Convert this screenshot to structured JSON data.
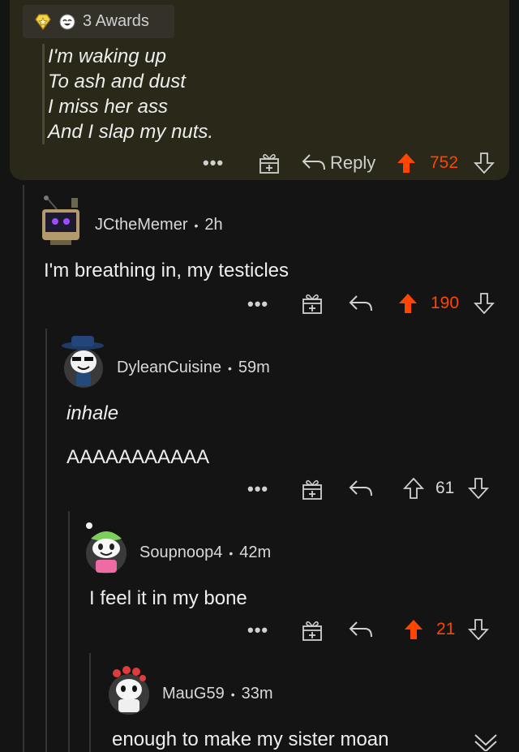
{
  "parent_comment": {
    "awards_label": "3 Awards",
    "lines": [
      "I'm waking up",
      "To ash and dust",
      "I miss her ass",
      "And I slap my nuts."
    ],
    "more_label": "•••",
    "reply_label": "Reply",
    "score": "752"
  },
  "comments": [
    {
      "username": "JCtheMemer",
      "sep": "•",
      "time": "2h",
      "text": "I'm breathing in, my testicles",
      "score": "190",
      "upvoted": true
    },
    {
      "username": "DyleanCuisine",
      "sep": "•",
      "time": "59m",
      "text_line1": "inhale",
      "text_line2": "AAAAAAAAAAA",
      "score": "61",
      "upvoted": false
    },
    {
      "username": "Soupnoop4",
      "sep": "•",
      "time": "42m",
      "text": "I feel it in my bone",
      "score": "21",
      "upvoted": true
    },
    {
      "username": "MauG59",
      "sep": "•",
      "time": "33m",
      "text": "enough to make my sister moan"
    }
  ],
  "colors": {
    "upvote": "#ff4500",
    "card_bg": "#2a2818",
    "page_bg": "#141414"
  }
}
